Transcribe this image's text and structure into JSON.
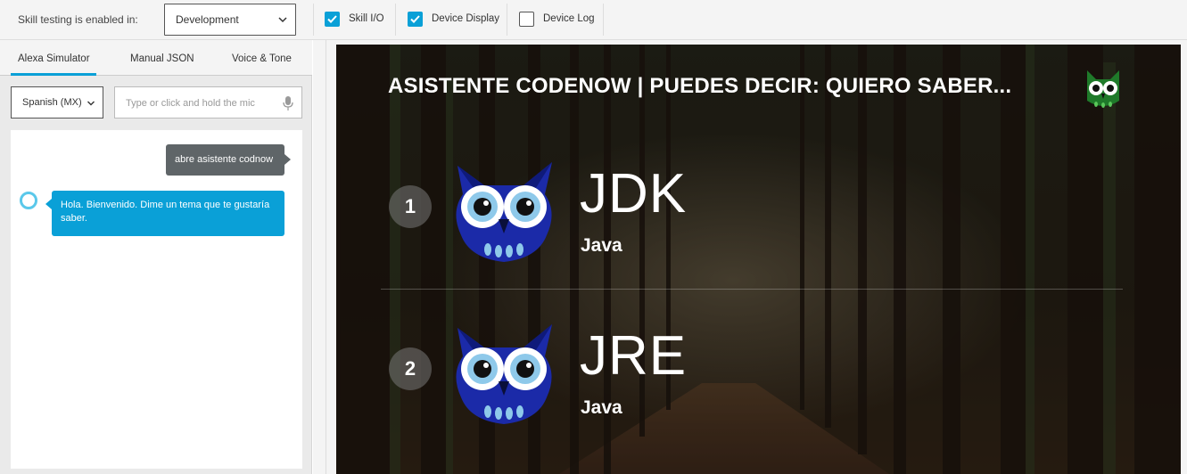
{
  "toolbar": {
    "testing_label": "Skill testing is enabled in:",
    "stage_value": "Development",
    "checkboxes": [
      {
        "label": "Skill I/O",
        "checked": true
      },
      {
        "label": "Device Display",
        "checked": true
      },
      {
        "label": "Device Log",
        "checked": false
      }
    ]
  },
  "simulator": {
    "tabs": [
      "Alexa Simulator",
      "Manual JSON",
      "Voice & Tone"
    ],
    "active_tab": "Alexa Simulator",
    "locale_value": "Spanish (MX)",
    "utterance_placeholder": "Type or click and hold the mic",
    "messages": {
      "user": "abre asistente codnow",
      "alexa": "Hola. Bienvenido. Dime un tema que te gustaría saber."
    }
  },
  "device": {
    "title": "ASISTENTE CODENOW | PUEDES DECIR: QUIERO SABER...",
    "logo_icon": "owl-logo-icon",
    "items": [
      {
        "number": "1",
        "primary": "JDK",
        "secondary": "Java"
      },
      {
        "number": "2",
        "primary": "JRE",
        "secondary": "Java"
      }
    ]
  },
  "colors": {
    "accent": "#0aa0d7",
    "user_bubble": "#5f6568",
    "owl_blue": "#1b2aa8"
  }
}
